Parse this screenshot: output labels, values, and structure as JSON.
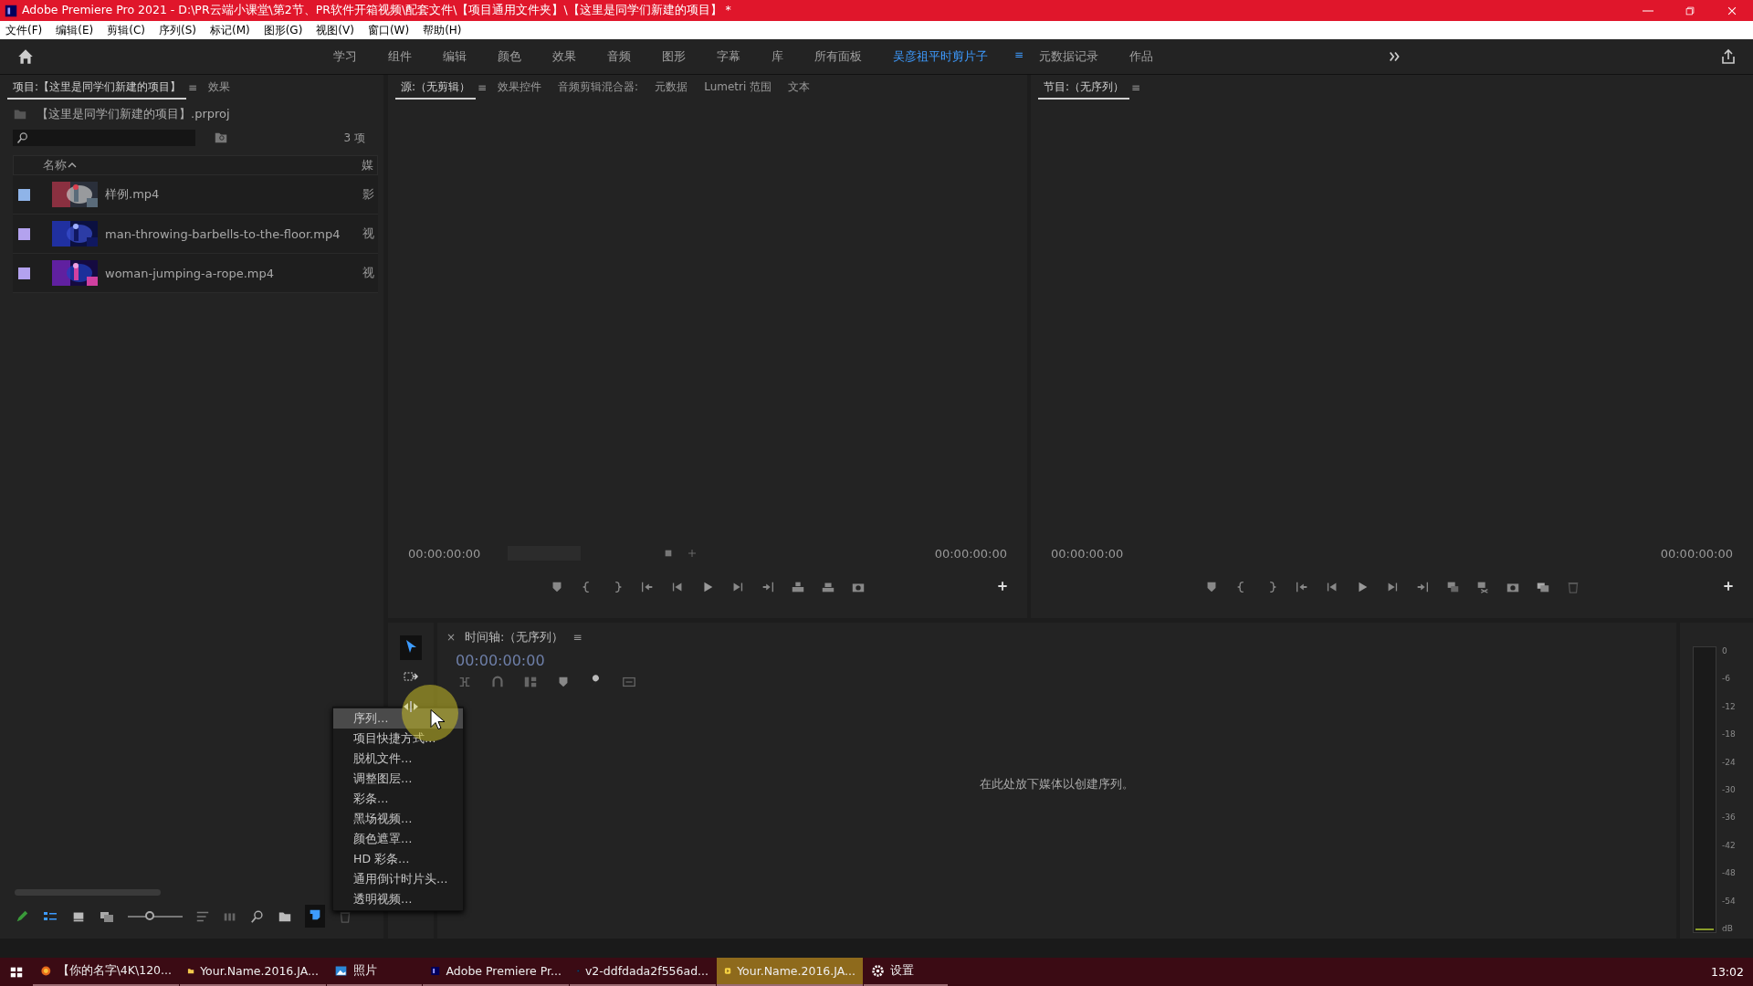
{
  "window": {
    "title": "Adobe Premiere Pro 2021 - D:\\PR云端小课堂\\第2节、PR软件开箱视频\\配套文件\\【项目通用文件夹】\\【这里是同学们新建的项目】 *"
  },
  "menu_bar": [
    "文件(F)",
    "编辑(E)",
    "剪辑(C)",
    "序列(S)",
    "标记(M)",
    "图形(G)",
    "视图(V)",
    "窗口(W)",
    "帮助(H)"
  ],
  "workspaces": [
    {
      "label": "学习",
      "selected": false
    },
    {
      "label": "组件",
      "selected": false
    },
    {
      "label": "编辑",
      "selected": false
    },
    {
      "label": "颜色",
      "selected": false
    },
    {
      "label": "效果",
      "selected": false
    },
    {
      "label": "音频",
      "selected": false
    },
    {
      "label": "图形",
      "selected": false
    },
    {
      "label": "字幕",
      "selected": false
    },
    {
      "label": "库",
      "selected": false
    },
    {
      "label": "所有面板",
      "selected": false
    },
    {
      "label": "吴彦祖平时剪片子",
      "selected": true,
      "menu": "≡"
    },
    {
      "label": "元数据记录",
      "selected": false
    },
    {
      "label": "作品",
      "selected": false
    }
  ],
  "project_panel": {
    "tabs": [
      {
        "label": "项目:【这里是同学们新建的项目】",
        "selected": true,
        "menu": "≡"
      },
      {
        "label": "效果",
        "selected": false
      }
    ],
    "file_name": "【这里是同学们新建的项目】.prproj",
    "item_count": "3 项",
    "columns": [
      "名称",
      "媒"
    ],
    "items": [
      {
        "name": "样例.mp4",
        "type": "影",
        "color": "#8fb4e8"
      },
      {
        "name": "man-throwing-barbells-to-the-floor.mp4",
        "type": "视",
        "color": "#b3a2ee"
      },
      {
        "name": "woman-jumping-a-rope.mp4",
        "type": "视",
        "color": "#b3a2ee"
      }
    ],
    "zoom": {
      "level": 0.4
    }
  },
  "source_monitor": {
    "tabs": [
      {
        "label": "源:（无剪辑）",
        "selected": true,
        "menu": "≡"
      },
      {
        "label": "效果控件",
        "selected": false
      },
      {
        "label": "音频剪辑混合器:",
        "selected": false
      },
      {
        "label": "元数据",
        "selected": false
      },
      {
        "label": "Lumetri 范围",
        "selected": false
      },
      {
        "label": "文本",
        "selected": false
      }
    ],
    "timecode_in": "00:00:00:00",
    "timecode_out": "00:00:00:00"
  },
  "program_monitor": {
    "tabs": [
      {
        "label": "节目:（无序列）",
        "selected": true,
        "menu": "≡"
      }
    ],
    "timecode_in": "00:00:00:00",
    "timecode_out": "00:00:00:00"
  },
  "timeline": {
    "close": "×",
    "title": "时间轴:（无序列）",
    "menu": "≡",
    "timecode": "00:00:00:00",
    "drop_hint": "在此处放下媒体以创建序列。"
  },
  "context_menu": [
    {
      "label": "序列…",
      "selected": true
    },
    {
      "label": "项目快捷方式…",
      "selected": false
    },
    {
      "label": "脱机文件…",
      "selected": false
    },
    {
      "label": "调整图层…",
      "selected": false
    },
    {
      "label": "彩条…",
      "selected": false
    },
    {
      "label": "黑场视频…",
      "selected": false
    },
    {
      "label": "颜色遮罩…",
      "selected": false
    },
    {
      "label": "HD 彩条…",
      "selected": false
    },
    {
      "label": "通用倒计时片头…",
      "selected": false
    },
    {
      "label": "透明视频…",
      "selected": false
    }
  ],
  "audio_meter": {
    "scale": [
      "0",
      "-6",
      "-12",
      "-18",
      "-24",
      "-30",
      "-36",
      "-42",
      "-48",
      "-54",
      "dB"
    ]
  },
  "taskbar": {
    "items": [
      {
        "label": "【你的名字\\4K\\120...",
        "selected": false,
        "kind": "browser"
      },
      {
        "label": "Your.Name.2016.JA...",
        "selected": false,
        "kind": "folder"
      },
      {
        "label": "照片",
        "selected": false,
        "kind": "photos"
      },
      {
        "label": "Adobe Premiere Pr...",
        "selected": false,
        "kind": "premiere"
      },
      {
        "label": "v2-ddfdada2f556ad...",
        "selected": false,
        "kind": "photoshop"
      },
      {
        "label": "Your.Name.2016.JA...",
        "selected": true,
        "kind": "player"
      },
      {
        "label": "设置",
        "selected": false,
        "kind": "settings"
      }
    ],
    "clock": "13:02"
  }
}
